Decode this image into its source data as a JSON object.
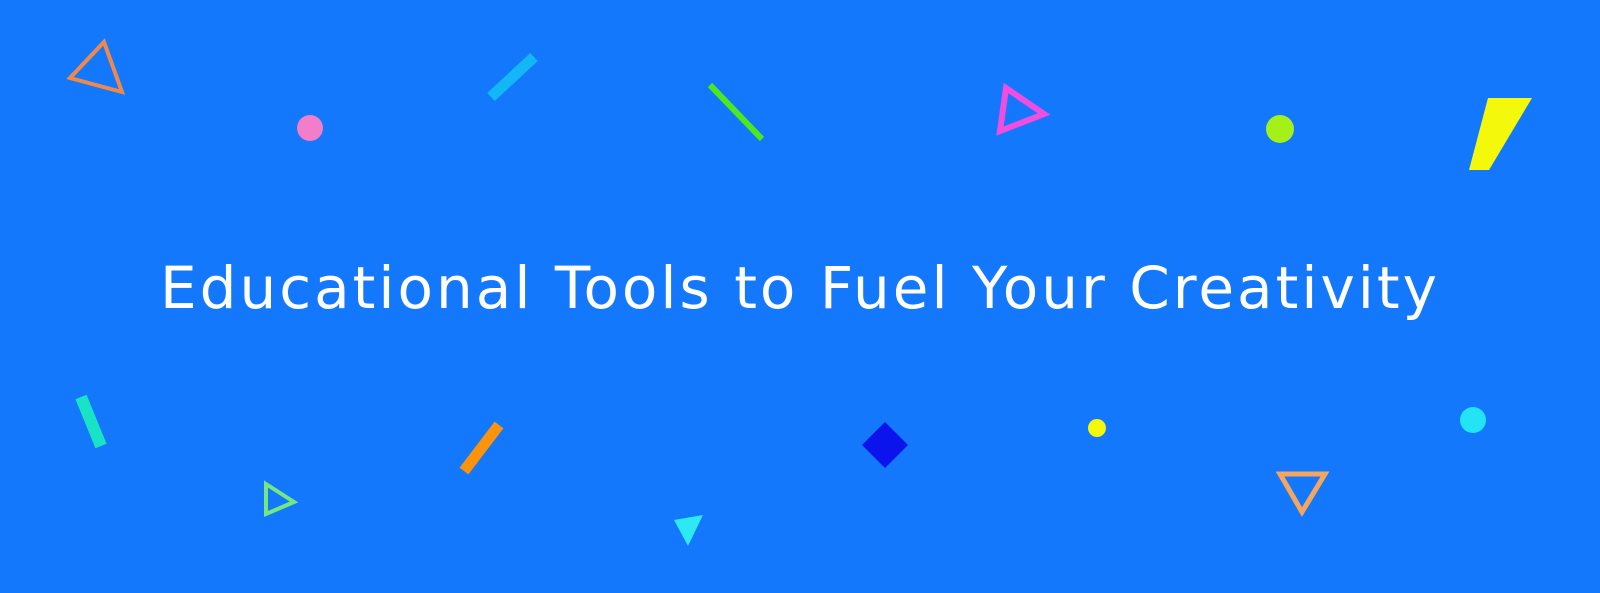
{
  "banner": {
    "headline": "Educational Tools to Fuel Your Creativity",
    "background_color": "#1478fd"
  },
  "decorations": {
    "palette": {
      "orange_outline": "#f0884a",
      "pink": "#f27ec9",
      "sky_blue": "#13b7f5",
      "green": "#4fe81d",
      "magenta": "#f04ee0",
      "lime": "#a6f019",
      "yellow": "#f4f80a",
      "teal": "#19e3c5",
      "light_green": "#74e87e",
      "orange": "#fb940a",
      "cyan": "#2fe9f2",
      "navy": "#0b14ec",
      "yellow_dot": "#f4f80a",
      "aqua": "#23e4f4",
      "peach_outline": "#f6a55f"
    }
  }
}
